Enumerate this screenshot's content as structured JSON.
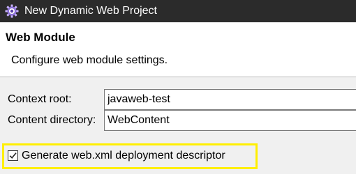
{
  "window": {
    "title": "New Dynamic Web Project",
    "app_icon": "eclipse-gear-icon"
  },
  "header": {
    "title": "Web Module",
    "description": "Configure web module settings."
  },
  "form": {
    "context_root": {
      "label": "Context root:",
      "value": "javaweb-test"
    },
    "content_directory": {
      "label": "Content directory:",
      "value": "WebContent"
    }
  },
  "options": {
    "generate_web_xml": {
      "label": "Generate web.xml deployment descriptor",
      "checked": true
    }
  },
  "colors": {
    "titlebar": "#2b2b2b",
    "highlight": "#ffef00",
    "header_background": "#ffffff",
    "dialog_background": "#f0f0f0"
  }
}
